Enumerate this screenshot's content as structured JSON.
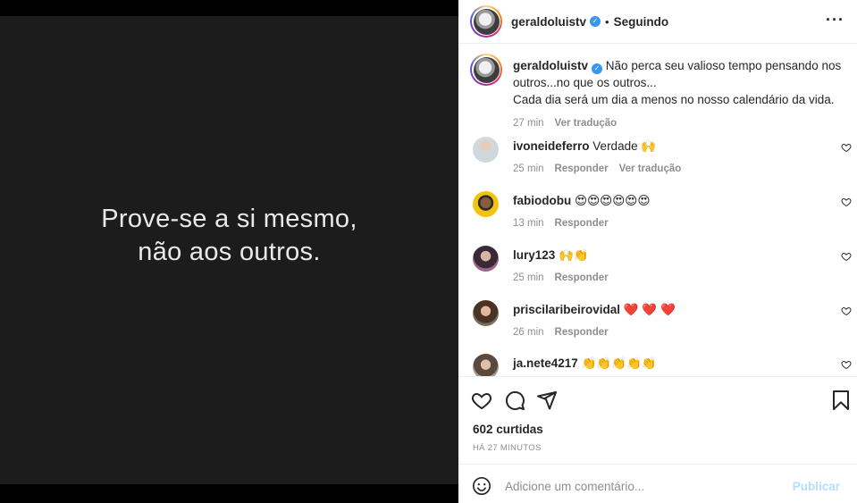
{
  "media": {
    "line1": "Prove-se a si mesmo,",
    "line2": "não aos outros."
  },
  "header": {
    "username": "geraldoluistv",
    "verified_mark": "✓",
    "separator": "•",
    "follow_status": "Seguindo",
    "more_icon": "···"
  },
  "caption": {
    "username": "geraldoluistv",
    "verified_mark": "✓",
    "text_line1": "Não perca seu valioso tempo pensando nos outros...no que os outros...",
    "text_line2": "Cada dia será um dia a menos no nosso calendário da vida.",
    "time": "27 min",
    "translate": "Ver tradução"
  },
  "comments": [
    {
      "username": "ivoneideferro",
      "text": "Verdade 🙌",
      "time": "25 min",
      "reply": "Responder",
      "translate": "Ver tradução"
    },
    {
      "username": "fabiodobu",
      "text": "😍😍😍😍😍😍",
      "time": "13 min",
      "reply": "Responder",
      "translate": ""
    },
    {
      "username": "lury123",
      "text": "🙌👏",
      "time": "25 min",
      "reply": "Responder",
      "translate": ""
    },
    {
      "username": "priscilaribeirovidal",
      "text": "❤️ ❤️ ❤️",
      "time": "26 min",
      "reply": "Responder",
      "translate": ""
    },
    {
      "username": "ja.nete4217",
      "text": "👏👏👏👏👏",
      "time": "",
      "reply": "",
      "translate": ""
    }
  ],
  "footer": {
    "likes": "602 curtidas",
    "posted_ago": "HÁ 27 MINUTOS",
    "comment_placeholder": "Adicione um comentário...",
    "post_button": "Publicar"
  },
  "icons": {
    "like": "heart-icon",
    "comment": "comment-bubble-icon",
    "share": "paper-plane-icon",
    "save": "bookmark-icon",
    "emoji": "smiley-icon",
    "comment_like": "heart-small-icon"
  },
  "colors": {
    "media_bg": "#1c1c1c",
    "verified": "#3897f0",
    "secondary_text": "#8e8e8e",
    "post_button": "#b2dffc",
    "heart_red": "#ed4956"
  }
}
